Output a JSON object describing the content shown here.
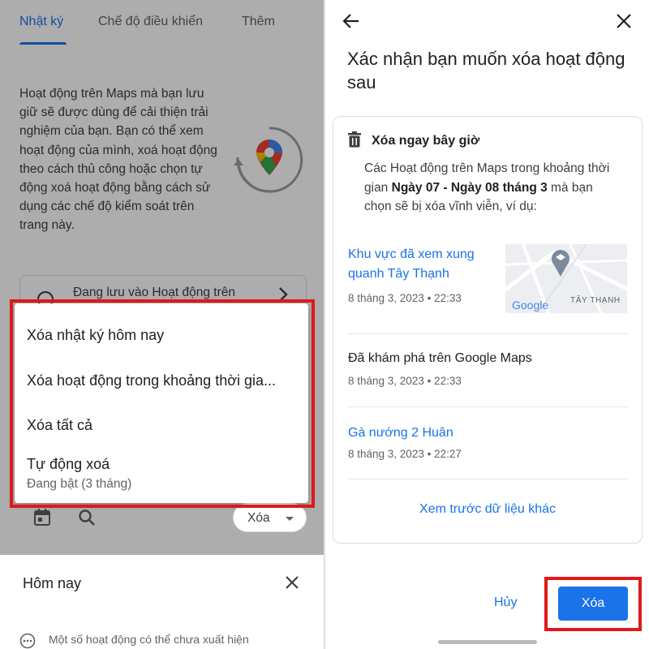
{
  "left": {
    "tabs": [
      {
        "label": "Nhật ký"
      },
      {
        "label": "Chế độ điều khiển"
      },
      {
        "label": "Thêm"
      }
    ],
    "intro": "Hoạt động trên Maps mà bạn lưu giữ sẽ được dùng để cải thiện trải nghiệm của bạn. Bạn có thể xem hoạt động của mình, xoá hoạt động theo cách thủ công hoặc chọn tự động xoá hoạt động bằng cách sử dụng các chế độ kiểm soát trên trang này.",
    "saving_card": "Đang lưu vào Hoạt động trên",
    "delete_chip": "Xóa",
    "menu": {
      "items": [
        {
          "label": "Xóa nhật ký hôm nay"
        },
        {
          "label": "Xóa hoạt động trong khoảng thời gia..."
        },
        {
          "label": "Xóa tất cả"
        },
        {
          "label": "Tự động xoá"
        }
      ],
      "auto_delete_sub": "Đang bật (3 tháng)"
    },
    "sheet": {
      "title": "Hôm nay",
      "note": "Một số hoạt động có thể chưa xuất hiện"
    }
  },
  "right": {
    "title": "Xác nhận bạn muốn xóa hoạt động sau",
    "card": {
      "heading": "Xóa ngay bây giờ",
      "desc_pre": "Các Hoạt động trên Maps trong khoảng thời gian ",
      "desc_bold": "Ngày 07 - Ngày 08 tháng 3",
      "desc_post": " mà bạn chọn sẽ bị xóa vĩnh viễn, ví dụ:",
      "activities": [
        {
          "title": "Khu vực đã xem xung quanh Tây Thạnh",
          "date": "8 tháng 3, 2023 • 22:33",
          "map_label": "TÂY THẠNH",
          "map_logo": "Google"
        },
        {
          "title": "Đã khám phá trên Google Maps",
          "date": "8 tháng 3, 2023 • 22:33"
        },
        {
          "title": "Gà nướng 2 Huân",
          "date": "8 tháng 3, 2023 • 22:27"
        }
      ],
      "preview_more": "Xem trước dữ liệu khác"
    },
    "cancel": "Hủy",
    "delete": "Xóa"
  },
  "colors": {
    "accent": "#1a73e8",
    "highlight": "#e0181b",
    "scrim": "rgba(0,0,0,0.32)"
  }
}
